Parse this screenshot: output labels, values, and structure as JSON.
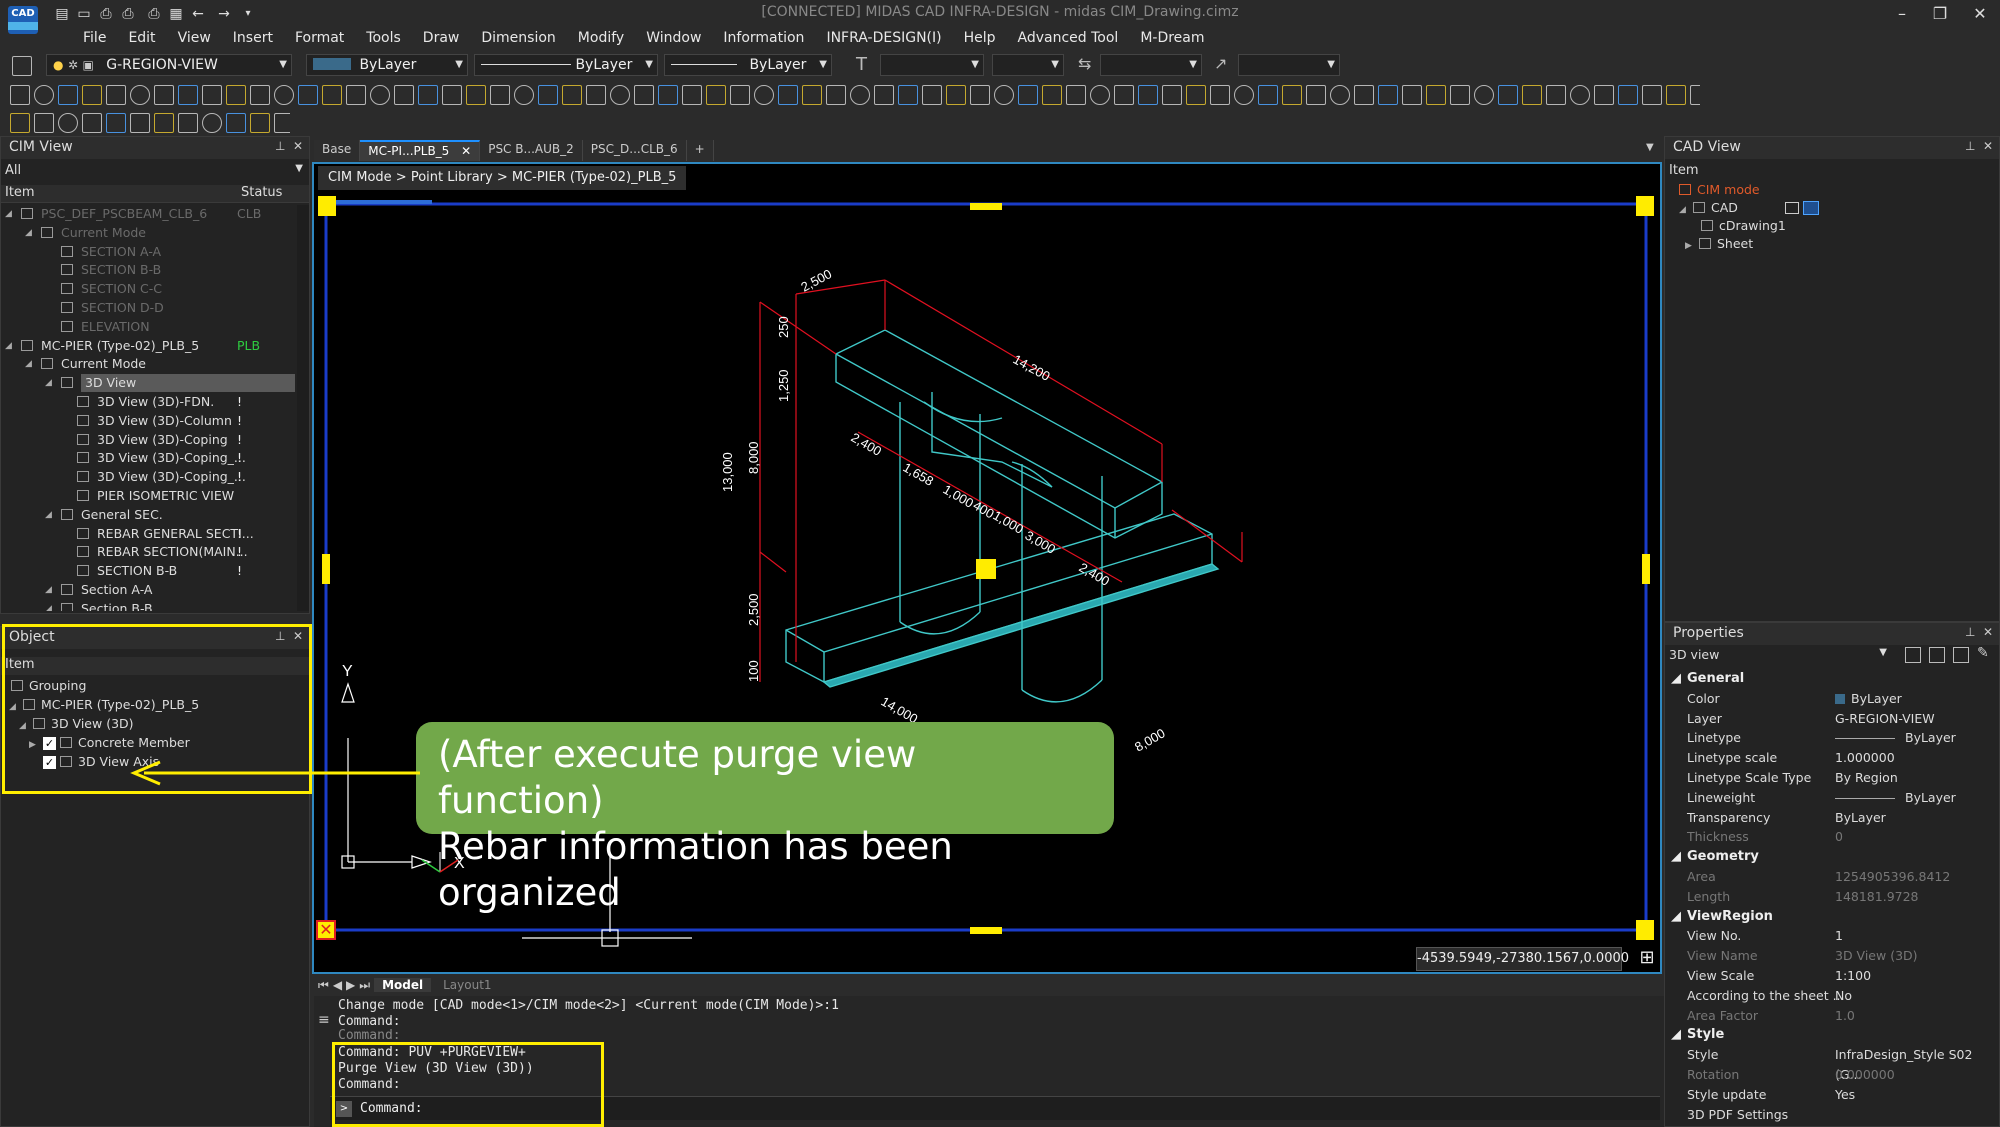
{
  "window": {
    "title": "[CONNECTED] MIDAS CAD INFRA-DESIGN - midas CIM_Drawing.cimz",
    "logo_text": "CAD"
  },
  "menu": [
    "File",
    "Edit",
    "View",
    "Insert",
    "Format",
    "Tools",
    "Draw",
    "Dimension",
    "Modify",
    "Window",
    "Information",
    "INFRA-DESIGN(I)",
    "Help",
    "Advanced Tool",
    "M-Dream"
  ],
  "toolbar": {
    "layer": "G-REGION-VIEW",
    "color": "ByLayer",
    "linetype": "ByLayer",
    "lineweight": "ByLayer"
  },
  "cim_view": {
    "title": "CIM View",
    "filter": "All",
    "col_item": "Item",
    "col_status": "Status",
    "rows": [
      {
        "label": "PSC_DEF_PSCBEAM_CLB_6",
        "status": "CLB",
        "dim": true
      },
      {
        "label": "Current Mode",
        "dim": true
      },
      {
        "label": "SECTION A-A",
        "dim": true
      },
      {
        "label": "SECTION B-B",
        "dim": true
      },
      {
        "label": "SECTION C-C",
        "dim": true
      },
      {
        "label": "SECTION D-D",
        "dim": true
      },
      {
        "label": "ELEVATION",
        "dim": true
      },
      {
        "label": "MC-PIER (Type-02)_PLB_5",
        "status": "PLB"
      },
      {
        "label": "Current Mode"
      },
      {
        "label": "3D View"
      },
      {
        "label": "3D View (3D)-FDN.",
        "warn": "!"
      },
      {
        "label": "3D View (3D)-Column",
        "warn": "!"
      },
      {
        "label": "3D View (3D)-Coping",
        "warn": "!"
      },
      {
        "label": "3D View (3D)-Coping_...",
        "warn": "!"
      },
      {
        "label": "3D View (3D)-Coping_...",
        "warn": "!"
      },
      {
        "label": "PIER ISOMETRIC VIEW"
      },
      {
        "label": "General SEC."
      },
      {
        "label": "REBAR GENERAL SECTI...",
        "warn": "!"
      },
      {
        "label": "REBAR SECTION(MAIN...",
        "warn": "!"
      },
      {
        "label": "SECTION B-B",
        "warn": "!"
      },
      {
        "label": "Section A-A"
      },
      {
        "label": "Section B-B"
      }
    ]
  },
  "object_panel": {
    "title": "Object",
    "col_item": "Item",
    "rows": [
      "Grouping",
      "MC-PIER (Type-02)_PLB_5",
      "3D View (3D)",
      "Concrete Member",
      "3D View Axis"
    ]
  },
  "tabs": [
    "Base",
    "MC-PI...PLB_5",
    "PSC B...AUB_2",
    "PSC_D...CLB_6",
    "+"
  ],
  "breadcrumb": "CIM Mode > Point Library > MC-PIER (Type-02)_PLB_5",
  "dims": [
    "2,500",
    "1,250",
    "250",
    "14,200",
    "13,000",
    "8,000",
    "2,400",
    "1,658",
    "1,000",
    "400",
    "1,000",
    "3,000",
    "2,400",
    "2,500",
    "100",
    "14,000",
    "8,000"
  ],
  "axis": {
    "x": "X",
    "y": "Y"
  },
  "coords": "-4539.5949,-27380.1567,0.0000",
  "layout_tabs": [
    "Model",
    "Layout1"
  ],
  "callout": {
    "line1": "(After execute purge view function)",
    "line2": "Rebar information has been organized"
  },
  "command": {
    "lines": [
      "Change mode [CAD mode<1>/CIM mode<2>] <Current mode(CIM Mode)>:1",
      "Command:",
      "Command:",
      "Command:  PUV +PURGEVIEW+",
      "Purge View (3D View (3D))",
      "Command:"
    ],
    "prompt": "Command:"
  },
  "cad_view": {
    "title": "CAD View",
    "col_item": "Item",
    "rows": [
      "CIM mode",
      "CAD",
      "cDrawing1",
      "Sheet"
    ]
  },
  "properties": {
    "title": "Properties",
    "selector": "3D view",
    "sections": [
      {
        "name": "General",
        "rows": [
          [
            "Color",
            "ByLayer"
          ],
          [
            "Layer",
            "G-REGION-VIEW"
          ],
          [
            "Linetype",
            "ByLayer"
          ],
          [
            "Linetype scale",
            "1.000000"
          ],
          [
            "Linetype Scale Type",
            "By Region"
          ],
          [
            "Lineweight",
            "ByLayer"
          ],
          [
            "Transparency",
            "ByLayer"
          ],
          [
            "Thickness",
            "0"
          ]
        ]
      },
      {
        "name": "Geometry",
        "rows": [
          [
            "Area",
            "1254905396.8412"
          ],
          [
            "Length",
            "148181.9728"
          ]
        ]
      },
      {
        "name": "ViewRegion",
        "rows": [
          [
            "View No.",
            "1"
          ],
          [
            "View Name",
            "3D View (3D)"
          ],
          [
            "View Scale",
            "1:100"
          ],
          [
            "According to the sheet ...",
            "No"
          ],
          [
            "Area Factor",
            "1.0"
          ]
        ]
      },
      {
        "name": "Style",
        "rows": [
          [
            "Style",
            "InfraDesign_Style S02 (G..."
          ],
          [
            "Rotation",
            "0.000000"
          ],
          [
            "Style update",
            "Yes"
          ],
          [
            "3D PDF Settings",
            ""
          ]
        ]
      }
    ]
  },
  "colors": {
    "accent": "#1e90ff",
    "highlight": "#ffee00",
    "callout": "#72a84a",
    "model": "#40c8c8",
    "dimension": "#e01020"
  }
}
